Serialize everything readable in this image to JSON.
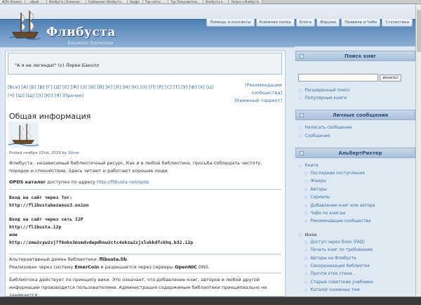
{
  "browser_tabs": [
    "Ф|Tor Browser",
    "…обраб. …",
    "Флибуста | Книжное…",
    "Сообщение: Флибуста…",
    "Google",
    "Тор-сайты: …",
    "Тор Пользователь…",
    "Флибуста в…",
    "Запрос в Флибуста"
  ],
  "site": {
    "title": "Флибуста",
    "subtitle": "Книжное братство"
  },
  "topnav": [
    "Помощь и контакты",
    "Книжная полка",
    "Блоги",
    "Форумы",
    "Правила и ЧаВо",
    "Статистика"
  ],
  "quote": "\"А я не легенда!\" (с) Лорен Бэколл",
  "alphabet": [
    "[Все]",
    "[А]",
    "[Б]",
    "[В]",
    "[Г]",
    "[Д]",
    "[Е]",
    "[Ж]",
    "[З]",
    "[И]",
    "[Й]",
    "[К]",
    "[Л]",
    "[М]",
    "[Н]",
    "[О]",
    "[П]",
    "[Р]",
    "[С]",
    "[Т]",
    "[У]",
    "[Ф]",
    "[Х]",
    "[Ц]",
    "[Ч]",
    "[Ш]",
    "[Щ]",
    "[Э]",
    "[Ю]",
    "[Я]",
    "[Прочее]"
  ],
  "extra_links": {
    "recommendations": "[Рекомендации сообщества]",
    "torrent": "[Книжный торрент]"
  },
  "article": {
    "title": "Общая информация",
    "posted_prefix": "Posted ноября 22nd, 2029 by",
    "author": "Stiver",
    "intro": "Флибуста - независимый библиотечный ресурс. Как и в любой библиотеке, просьба соблюдать чистоту, порядок и спокойствие. Здесь читают и работают хорошие люди.",
    "opds_label": "OPDS каталог",
    "opds_text": "доступен по адресу",
    "opds_url": "http://flibusta.net/opds",
    "tor_label": "Вход на сайт через Tor:",
    "tor_url": "http://flibustahezeous3.onion",
    "i2p_label_prefix": "Вход на сайт через сеть",
    "i2p_label_link": "I2P",
    "i2p_url": "http://flibusta.i2p",
    "or": "или",
    "i2p_url_long": "http://zmw2cyw2vj7f6obx3msmdvdepdhnw2ctc4okza2zjxlukkdfckhq.b32.i2p",
    "alt_domain_prefix": "Альтернативный домен библиотеки:",
    "alt_domain": "flibusta.lib",
    "emer_prefix": "Реализован через систему",
    "emer_link": "EmerCoin",
    "emer_mid": "и разрешается через серверы",
    "opennic_link": "OpenNIC",
    "emer_suffix": "DNS.",
    "wiki_text": "Библиотека действует по принципу вики. Это означает, что добавление книг, авторов и любой другой информации производится пользователями. Администрация содержимым библиотеки принципиально не занимается."
  },
  "sidebar": {
    "search": {
      "title": "Поиск книг",
      "button": "искать!",
      "value": "",
      "links": [
        "Расширенный поиск",
        "Популярные книги"
      ]
    },
    "messages": {
      "title": "Личные сообщения",
      "links": [
        "Написать сообщение",
        "Сообщения"
      ]
    },
    "user": {
      "title": "АльбертРихтер",
      "books_label": "Книги",
      "books_links": [
        "Последние поступления",
        "Жанры",
        "Авторы",
        "Сериалы",
        "Добавление книг или автора",
        "ЧаВо по книгам",
        "Рекомендации сообщества"
      ],
      "other_label": "Иное",
      "other_links": [
        "Доступ через блок (FAQ)",
        "Печать книг по требованию",
        "Авторы на Флибусте",
        "Синхронизация библиотек",
        "Прочти этих стихи…",
        "Старые советские учебники",
        "Каталог книжных тем"
      ]
    }
  }
}
